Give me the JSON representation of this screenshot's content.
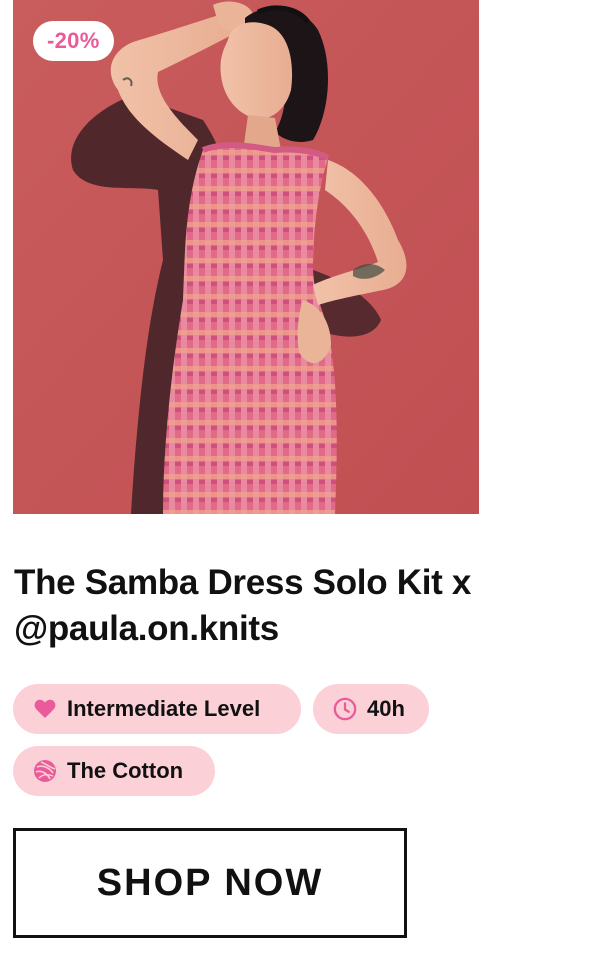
{
  "product": {
    "discount_badge": "-20%",
    "title": "The Samba Dress Solo Kit x @paula.on.knits",
    "image_alt": "Woman wearing a pink knitted ribbed dress against a red wall"
  },
  "tags": [
    {
      "label": "Intermediate Level",
      "icon": "heart-icon"
    },
    {
      "label": "40h",
      "icon": "clock-icon"
    },
    {
      "label": "The Cotton",
      "icon": "yarn-ball-icon"
    }
  ],
  "cta": {
    "label": "SHOP NOW"
  },
  "colors": {
    "accent": "#ea5b9a",
    "pill_bg": "#fbd0d6",
    "photo_bg": "#c8595a",
    "text": "#111111"
  }
}
